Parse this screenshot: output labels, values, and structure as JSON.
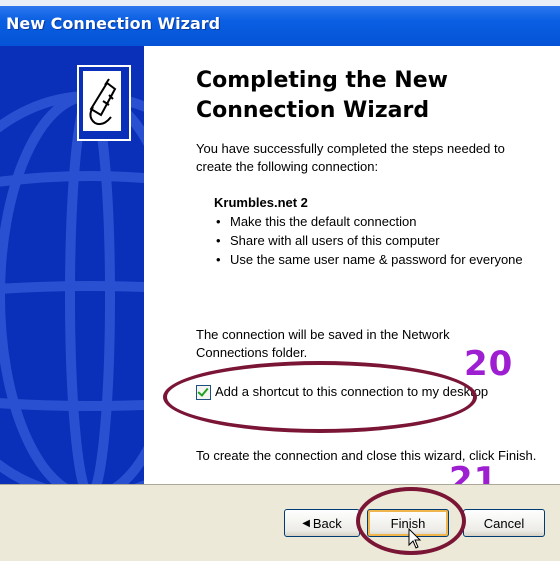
{
  "window": {
    "title": "New Connection Wizard"
  },
  "main": {
    "heading": "Completing the New Connection Wizard",
    "intro": "You have successfully completed the steps needed to create the following connection:",
    "connection_name": "Krumbles.net 2",
    "details": [
      "Make this the default connection",
      "Share with all users of this computer",
      "Use the same user name & password for everyone"
    ],
    "saved_note": "The connection will be saved in the Network Connections folder.",
    "shortcut_checkbox": {
      "label": "Add a shortcut to this connection to my desktop",
      "checked": true
    },
    "finish_note": "To create the connection and close this wizard, click Finish."
  },
  "buttons": {
    "back": "Back",
    "finish": "Finish",
    "cancel": "Cancel"
  },
  "annotations": {
    "step_20": "20",
    "step_21": "21",
    "color": "#9e1fd1",
    "ellipse_color": "#7a1536"
  },
  "icons": {
    "wizard": "phone-connection-icon",
    "back_arrow": "chevron-left-icon",
    "cursor": "mouse-pointer-icon"
  },
  "colors": {
    "title_bar": "#0553d6",
    "side_panel": "#0a2fb8",
    "dialog_bg": "#ece9d8"
  }
}
